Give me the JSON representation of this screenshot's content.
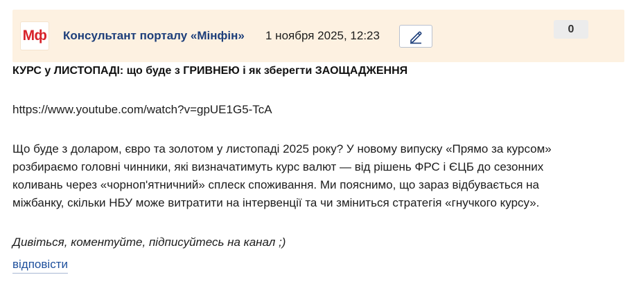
{
  "header": {
    "logo_text": "Мф",
    "author": "Консультант порталу «Мінфін»",
    "date": "1 ноября 2025, 12:23",
    "edit_icon": "pencil-icon",
    "counter": "0"
  },
  "post": {
    "title": "КУРС у ЛИСТОПАДІ: що буде з ГРИВНЕЮ і як зберегти ЗАОЩАДЖЕННЯ",
    "link": "https://www.youtube.com/watch?v=gpUE1G5-TcA",
    "body_lines": [
      "Що буде з доларом, євро та золотом у листопаді 2025 року? У новому випуску «Прямо за курсом»",
      "розбираємо головні чинники, які визначатимуть курс валют — від рішень ФРС і ЄЦБ до сезонних",
      "коливань через «чорноп'ятничний» сплеск споживання. Ми пояснимо, що зараз відбувається на",
      "міжбанку, скільки НБУ може витратити на інтервенції та чи зміниться стратегія «гнучкого курсу»."
    ],
    "signoff": "Дивіться, коментуйте, підписуйтесь на канал ;)"
  },
  "actions": {
    "reply_label": "відповісти"
  },
  "colors": {
    "header_bg": "#fdf1e1",
    "logo_red": "#d8232a",
    "author_blue": "#1d3e7a",
    "link_blue": "#1d4f9c"
  }
}
